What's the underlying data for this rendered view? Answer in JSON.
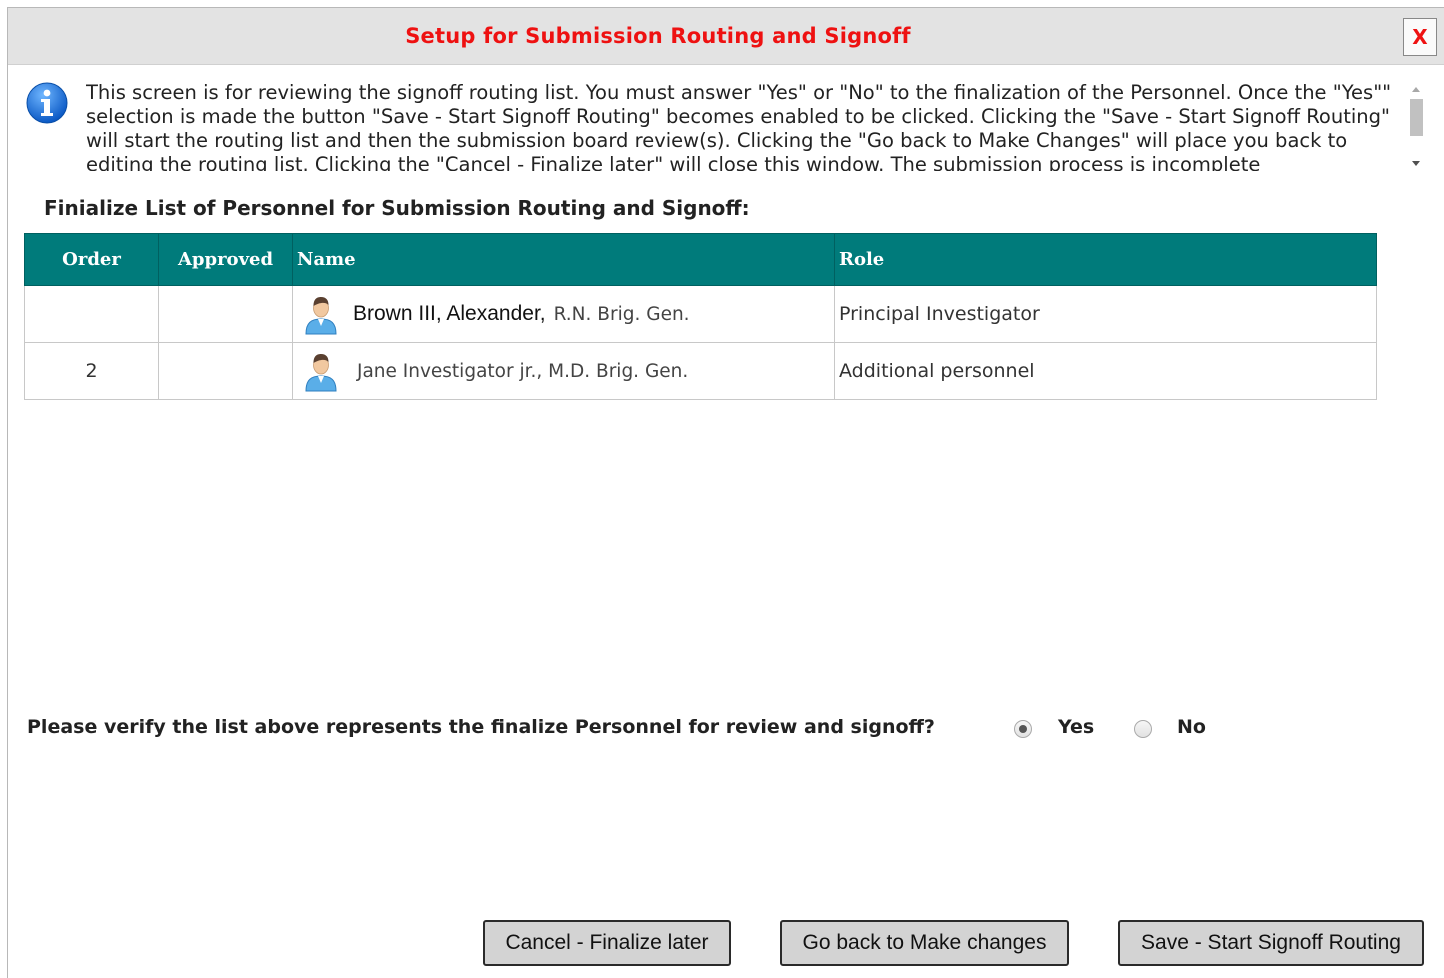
{
  "dialog": {
    "title": "Setup for Submission Routing and Signoff",
    "close_label": "X"
  },
  "info": {
    "text": "This screen is for reviewing the signoff routing list. You must answer \"Yes\" or \"No\" to the finalization of the Personnel. Once the \"Yes\"\" selection is made the button \"Save - Start Signoff Routing\" becomes enabled to be clicked. Clicking the \"Save - Start Signoff Routing\" will start the routing list and then the submission board review(s). Clicking the \"Go back to Make Changes\" will place you back to editing the routing list. Clicking the \"Cancel - Finalize later\" will close this window. The submission process is incomplete"
  },
  "section_heading": "Finialize List of Personnel for Submission Routing and Signoff:",
  "table": {
    "headers": {
      "order": "Order",
      "approved": "Approved",
      "name": "Name",
      "role": "Role"
    },
    "rows": [
      {
        "order": "",
        "approved": "",
        "name": "Brown III, Alexander,",
        "suffix": "R.N. Brig. Gen.",
        "role": "Principal Investigator",
        "icon": "person-icon"
      },
      {
        "order": "2",
        "approved": "",
        "name": "",
        "suffix": "Jane Investigator jr., M.D. Brig. Gen.",
        "role": "Additional personnel",
        "icon": "person-icon"
      }
    ]
  },
  "verify": {
    "question": "Please verify the list above represents the finalize Personnel for review and signoff?",
    "options": [
      {
        "label": "Yes",
        "checked": true
      },
      {
        "label": "No",
        "checked": false
      }
    ]
  },
  "buttons": {
    "cancel": "Cancel - Finalize later",
    "go_back": "Go back to Make changes",
    "save": "Save - Start Signoff Routing"
  },
  "colors": {
    "title_red": "#ee1111",
    "header_teal": "#007b7b",
    "button_gray": "#d3d3d3"
  }
}
